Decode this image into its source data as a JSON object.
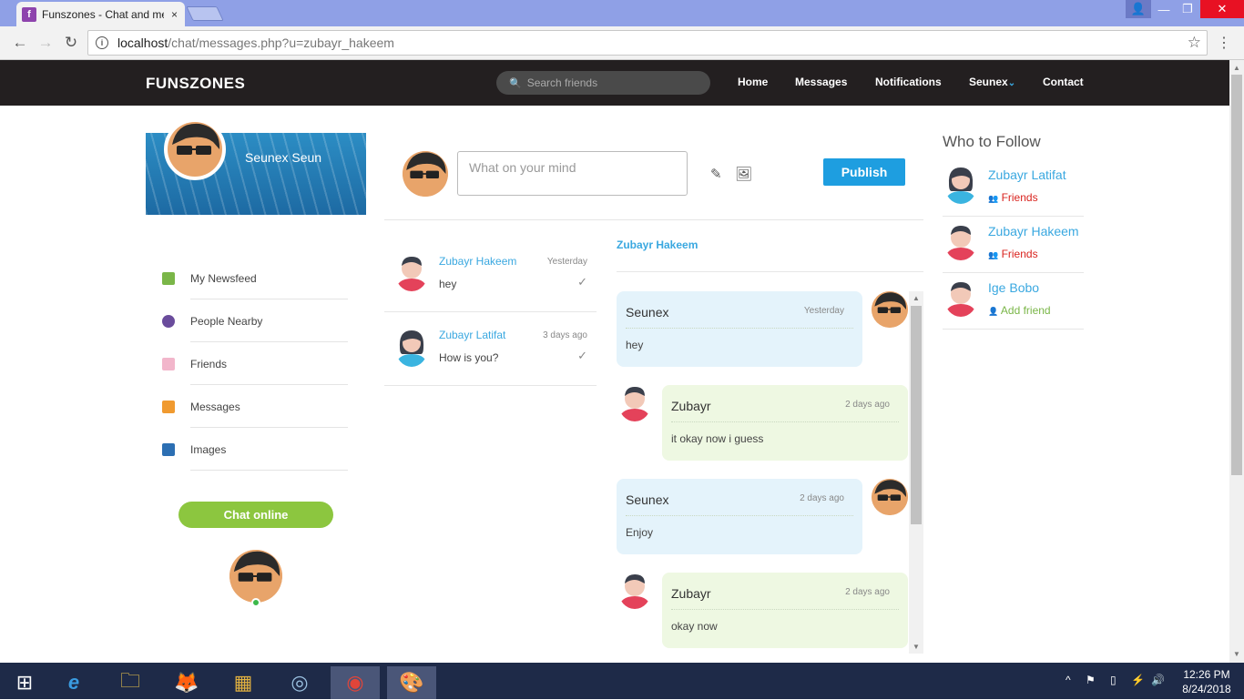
{
  "browser": {
    "tab_title": "Funszones - Chat and me",
    "tab_close": "×",
    "favicon_letter": "f",
    "url_host": "localhost",
    "url_path": "/chat/messages.php?u=zubayr_hakeem",
    "user_glyph": "👤",
    "minimize": "—",
    "restore": "❐",
    "close": "✕",
    "back": "←",
    "forward": "→",
    "reload": "↻",
    "info": "i",
    "star": "☆",
    "menu": "⋮"
  },
  "nav": {
    "brand": "FUNSZONES",
    "search_placeholder": "Search friends",
    "search_glyph": "🔍",
    "links": [
      "Home",
      "Messages",
      "Notifications",
      "Seunex",
      "Contact"
    ],
    "chevron": "⌄"
  },
  "profile": {
    "name": "Seunex Seun"
  },
  "sidebar": {
    "items": [
      {
        "label": "My Newsfeed",
        "color": "#7ab648"
      },
      {
        "label": "People Nearby",
        "color": "#6a4c9c"
      },
      {
        "label": "Friends",
        "color": "#e0709a"
      },
      {
        "label": "Messages",
        "color": "#f09a30"
      },
      {
        "label": "Images",
        "color": "#2c6fb3"
      }
    ],
    "chat_button": "Chat online"
  },
  "composer": {
    "placeholder": "What on your mind",
    "publish": "Publish",
    "edit_glyph": "✎",
    "image_glyph": "🖼"
  },
  "conversations": [
    {
      "name": "Zubayr Hakeem",
      "time": "Yesterday",
      "message": "hey",
      "check": "✓",
      "gender": "male"
    },
    {
      "name": "Zubayr Latifat",
      "time": "3 days ago",
      "message": "How is you?",
      "check": "✓",
      "gender": "female"
    }
  ],
  "chat": {
    "header": "Zubayr Hakeem",
    "messages": [
      {
        "sender": "Seunex",
        "time": "Yesterday",
        "text": "hey",
        "side": "me"
      },
      {
        "sender": "Zubayr",
        "time": "2 days ago",
        "text": "it okay now i guess",
        "side": "them"
      },
      {
        "sender": "Seunex",
        "time": "2 days ago",
        "text": "Enjoy",
        "side": "me"
      },
      {
        "sender": "Zubayr",
        "time": "2 days ago",
        "text": "okay now",
        "side": "them"
      }
    ]
  },
  "who_to_follow": {
    "title": "Who to Follow",
    "people": [
      {
        "name": "Zubayr Latifat",
        "status": "Friends",
        "status_glyph": "👥",
        "status_color": "#d9231e",
        "gender": "female"
      },
      {
        "name": "Zubayr Hakeem",
        "status": "Friends",
        "status_glyph": "👥",
        "status_color": "#d9231e",
        "gender": "male"
      },
      {
        "name": "Ige Bobo",
        "status": "Add friend",
        "status_glyph": "👤",
        "status_color": "#7ab648",
        "gender": "male"
      }
    ]
  },
  "taskbar": {
    "icons": [
      "windows-start",
      "internet-explorer",
      "file-explorer",
      "firefox",
      "calculator",
      "camera",
      "chrome",
      "paint"
    ],
    "glyphs": [
      "⊞",
      "e",
      "🗀",
      "🦊",
      "▦",
      "◎",
      "◉",
      "🎨"
    ],
    "clock_time": "12:26 PM",
    "clock_date": "8/24/2018",
    "tray_glyphs": [
      "^",
      "⚑",
      "▯",
      "⚡",
      "🔊"
    ]
  },
  "colors": {
    "accent": "#3aa8e0",
    "publish": "#1e9ee0",
    "chat_online": "#8cc63f",
    "navbar": "#231f20"
  }
}
